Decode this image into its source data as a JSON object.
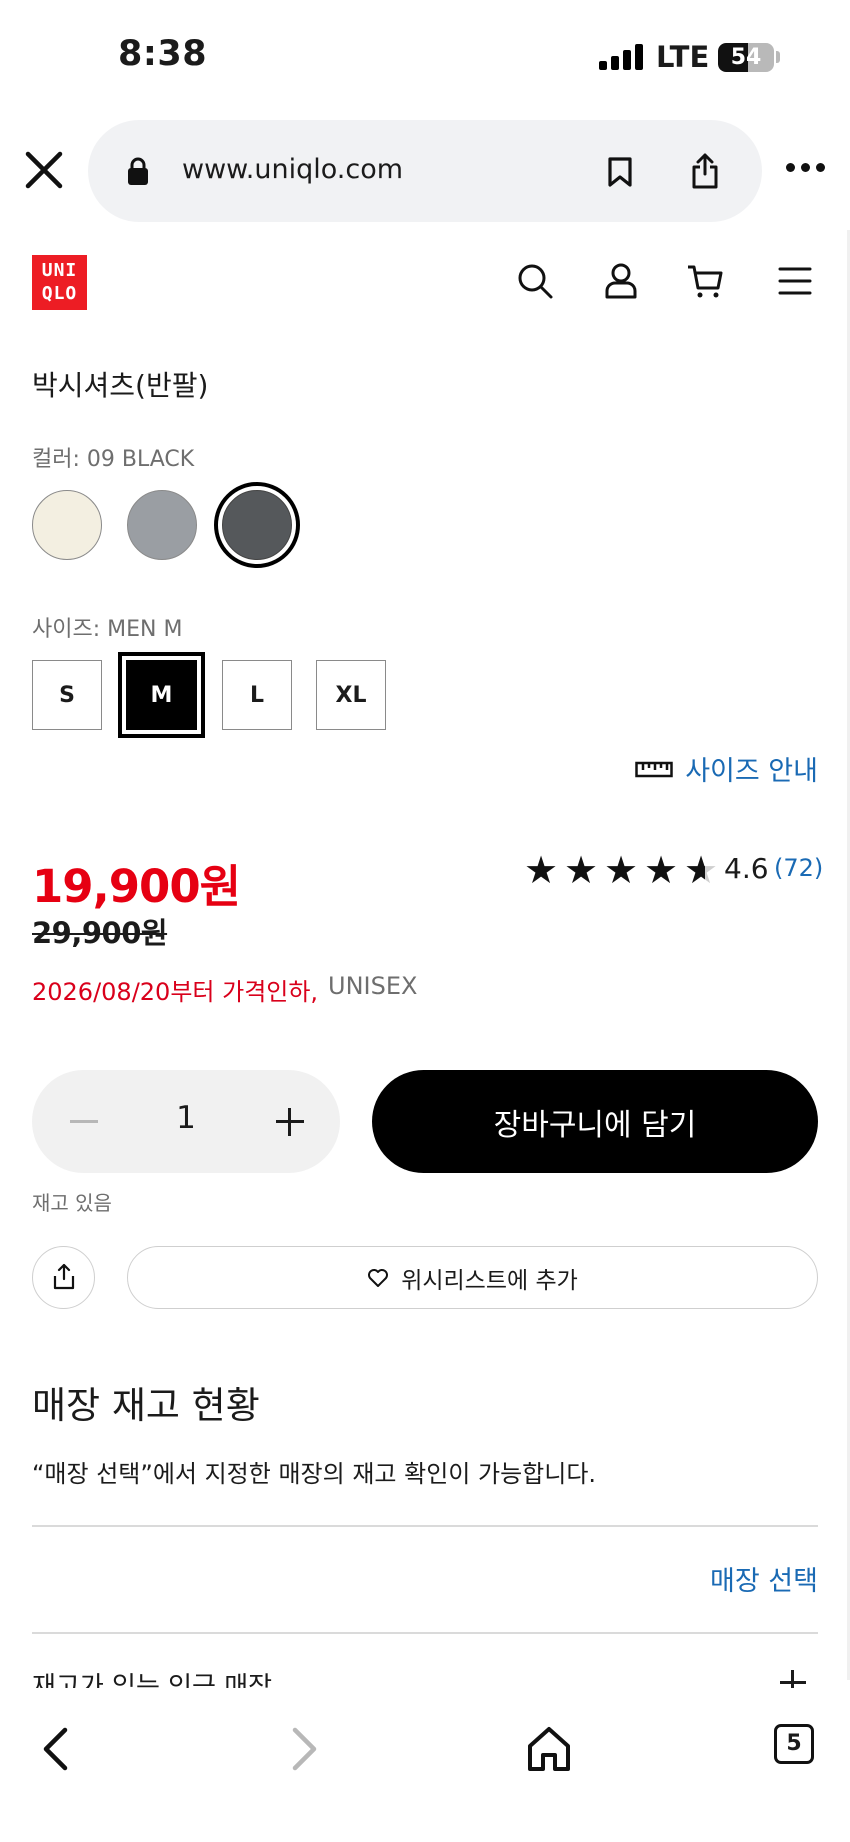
{
  "status_bar": {
    "time": "8:38",
    "network": "LTE",
    "battery": "54",
    "battery_level": 0.54
  },
  "browser": {
    "url": "www.uniqlo.com",
    "open_tabs": "5"
  },
  "header": {
    "logo_lines": [
      "UNI",
      "QLO"
    ],
    "brand_color": "#ed1d24"
  },
  "product": {
    "title": "박시셔츠(반팔)",
    "color_label": "컬러: 09 BLACK",
    "colors": [
      {
        "name": "off-white",
        "hex": "#f3efe1"
      },
      {
        "name": "gray",
        "hex": "#9a9ea3"
      },
      {
        "name": "black",
        "hex": "#55585b",
        "selected": true
      }
    ],
    "size_label": "사이즈: MEN M",
    "sizes": [
      "S",
      "M",
      "L",
      "XL"
    ],
    "selected_size": "M",
    "size_guide": "사이즈 안내",
    "price": "19,900원",
    "original_price": "29,900원",
    "rating": "4.6",
    "rating_value": 4.6,
    "review_count": "(72)",
    "price_note": "2026/08/20부터 가격인하,",
    "gender": "UNISEX",
    "quantity": "1",
    "add_to_cart": "장바구니에 담기",
    "stock_status": "재고 있음",
    "wishlist": "위시리스트에 추가"
  },
  "store_stock": {
    "title": "매장 재고 현황",
    "description": "“매장 선택”에서 지정한 매장의 재고 확인이 가능합니다.",
    "select_store": "매장 선택",
    "nearby_stores": "재고가 있는 인근 매장"
  },
  "colors": {
    "sale_red": "#e60012",
    "link_blue": "#1a6ab4"
  }
}
